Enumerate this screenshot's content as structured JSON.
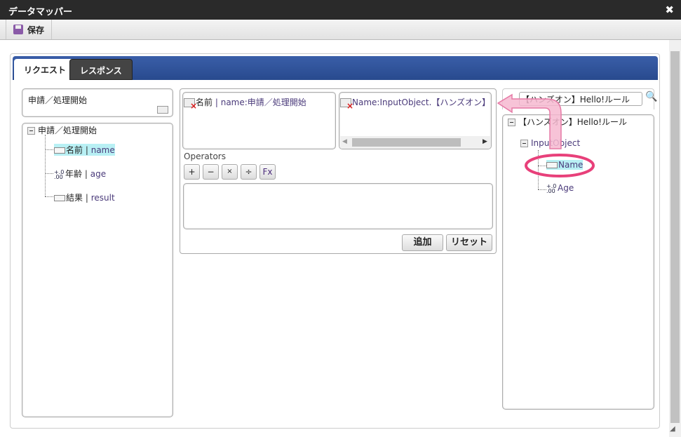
{
  "window": {
    "title": "データマッパー",
    "close_icon": "close-icon"
  },
  "toolbar": {
    "save_label": "保存"
  },
  "tabs": [
    {
      "label": "リクエスト",
      "active": true
    },
    {
      "label": "レスポンス",
      "active": false
    }
  ],
  "left": {
    "selected_label": "申請／処理開始",
    "tree": {
      "root": "申請／処理開始",
      "items": [
        {
          "label": "名前",
          "sep": "|",
          "key": "name",
          "type": "string",
          "selected": true
        },
        {
          "label": "年齢",
          "sep": "|",
          "key": "age",
          "type": "number"
        },
        {
          "label": "結果",
          "sep": "|",
          "key": "result",
          "type": "string"
        }
      ]
    }
  },
  "middle": {
    "source": {
      "label": "名前",
      "sep": "|",
      "text": "name:申請／処理開始"
    },
    "target": {
      "text": "Name:InputObject.【ハンズオン】Hello!"
    },
    "operators_label": "Operators",
    "operators": [
      "+",
      "−",
      "×",
      "÷",
      "Fx"
    ],
    "expression": "",
    "add_label": "追加",
    "reset_label": "リセット"
  },
  "right": {
    "search_value": "【ハンズオン】Hello!ルール",
    "tree": {
      "root": "【ハンズオン】Hello!ルール",
      "child": "InputObject",
      "items": [
        {
          "label": "Name",
          "type": "string",
          "selected": true
        },
        {
          "label": "Age",
          "type": "number"
        }
      ]
    }
  },
  "annotation": {
    "color": "#e8407a"
  }
}
